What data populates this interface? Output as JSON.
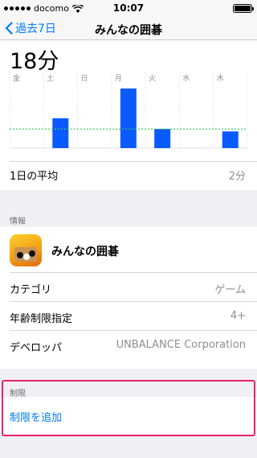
{
  "status_bar": {
    "carrier": "docomo",
    "time": "10:07"
  },
  "nav": {
    "back_label": "過去7日",
    "title": "みんなの囲碁"
  },
  "usage": {
    "total_time": "18分",
    "average_label": "1日の平均",
    "average_value": "2分"
  },
  "chart_data": {
    "type": "bar",
    "categories": [
      "金",
      "土",
      "日",
      "月",
      "火",
      "水",
      "木"
    ],
    "values": [
      0,
      2.5,
      0,
      5.0,
      1.6,
      0,
      1.4
    ],
    "average": 1.6,
    "unit": "分",
    "bar_color": "#0a5bff",
    "average_line_color": "#34c759",
    "grid": true
  },
  "info": {
    "section_title": "情報",
    "app_name": "みんなの囲碁",
    "rows": [
      {
        "label": "カテゴリ",
        "value": "ゲーム"
      },
      {
        "label": "年齢制限指定",
        "value": "4+"
      },
      {
        "label": "デベロッパ",
        "value": "UNBALANCE Corporation"
      }
    ]
  },
  "limits": {
    "section_title": "制限",
    "add_label": "制限を追加"
  },
  "colors": {
    "accent": "#007aff",
    "highlight_border": "#e5236b"
  }
}
